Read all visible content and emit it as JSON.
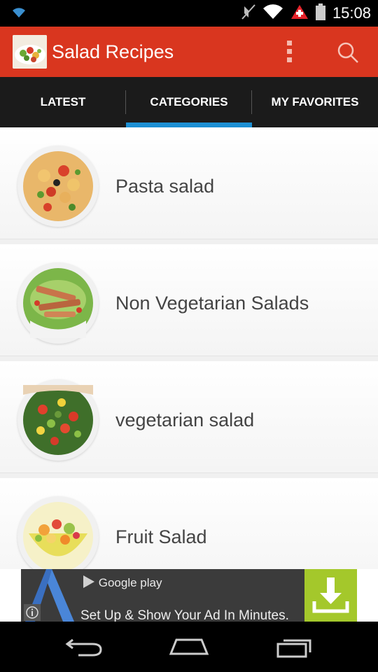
{
  "status_bar": {
    "time": "15:08"
  },
  "app_bar": {
    "title": "Salad Recipes"
  },
  "tabs": [
    {
      "label": "LATEST",
      "active": false
    },
    {
      "label": "CATEGORIES",
      "active": true
    },
    {
      "label": "MY FAVORITES",
      "active": false
    }
  ],
  "categories": [
    {
      "label": "Pasta salad"
    },
    {
      "label": "Non Vegetarian Salads"
    },
    {
      "label": "vegetarian salad"
    },
    {
      "label": "Fruit Salad"
    }
  ],
  "ad": {
    "store": "Google play",
    "text": "Set Up & Show Your Ad In Minutes."
  },
  "colors": {
    "app_bar": "#d9361f",
    "tab_indicator": "#1c8fd3",
    "ad_download": "#a4c82b"
  }
}
